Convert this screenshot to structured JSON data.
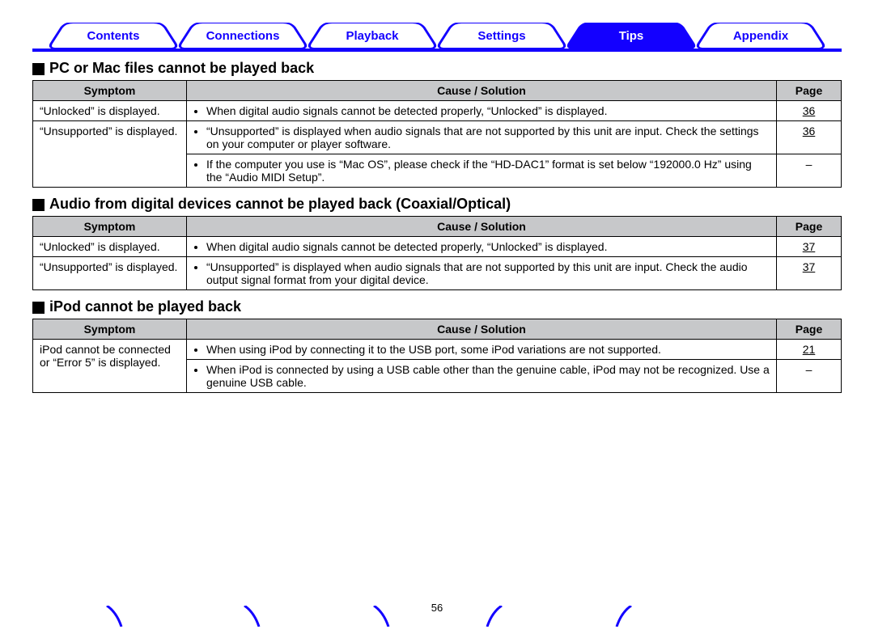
{
  "tabs": {
    "items": [
      {
        "label": "Contents",
        "active": false
      },
      {
        "label": "Connections",
        "active": false
      },
      {
        "label": "Playback",
        "active": false
      },
      {
        "label": "Settings",
        "active": false
      },
      {
        "label": "Tips",
        "active": true
      },
      {
        "label": "Appendix",
        "active": false
      }
    ]
  },
  "headers": {
    "symptom": "Symptom",
    "cause": "Cause / Solution",
    "page": "Page"
  },
  "sections": [
    {
      "title": "PC or Mac files cannot be played back",
      "rows": [
        {
          "symptom": "“Unlocked” is displayed.",
          "sol": "When digital audio signals cannot be detected properly, “Unlocked” is displayed.",
          "page": "36"
        },
        {
          "symptom": "“Unsupported” is displayed.",
          "sol": "“Unsupported” is displayed when audio signals that are not supported by this unit are input. Check the settings on your computer or player software.",
          "page": "36"
        },
        {
          "symptom": "",
          "sol": "If the computer you use is “Mac OS”, please check if the “HD-DAC1” format is set below “192000.0 Hz” using the “Audio MIDI Setup”.",
          "page": "–"
        }
      ]
    },
    {
      "title": "Audio from digital devices cannot be played back (Coaxial/Optical)",
      "rows": [
        {
          "symptom": "“Unlocked” is displayed.",
          "sol": "When digital audio signals cannot be detected properly, “Unlocked” is displayed.",
          "page": "37"
        },
        {
          "symptom": "“Unsupported” is displayed.",
          "sol": "“Unsupported” is displayed when audio signals that are not supported by this unit are input. Check the audio output signal format from your digital device.",
          "page": "37"
        }
      ]
    },
    {
      "title": "iPod cannot be played back",
      "rows": [
        {
          "symptom": "iPod cannot be connected or “Error 5” is displayed.",
          "sol": "When using iPod by connecting it to the USB port, some iPod variations are not supported.",
          "page": "21"
        },
        {
          "symptom": "",
          "sol": "When iPod is connected by using a USB cable other than the genuine cable, iPod may not be recognized. Use a genuine USB cable.",
          "page": "–"
        }
      ]
    }
  ],
  "page_number": "56"
}
